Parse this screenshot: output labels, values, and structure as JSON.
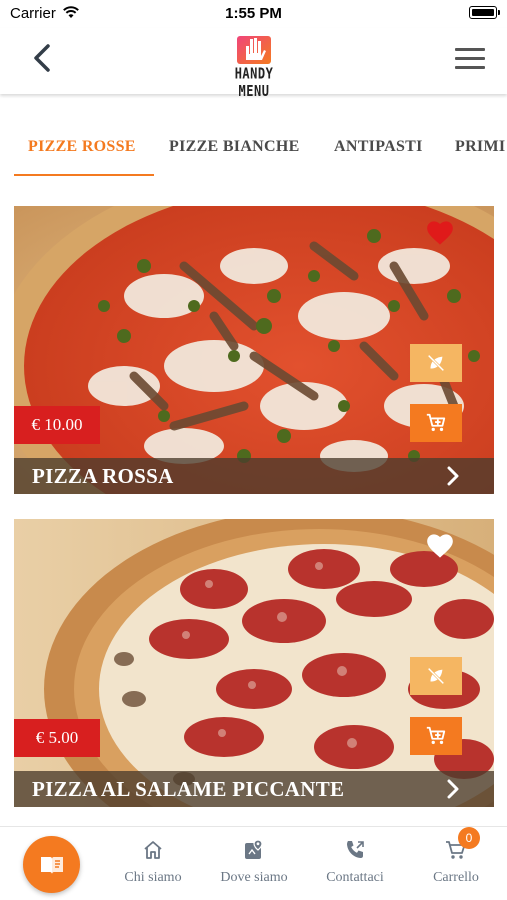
{
  "status_bar": {
    "carrier": "Carrier",
    "time": "1:55 PM"
  },
  "header": {
    "logo_text": "HANDY MENU"
  },
  "tabs": [
    {
      "label": "PIZZE ROSSE",
      "active": true
    },
    {
      "label": "PIZZE BIANCHE",
      "active": false
    },
    {
      "label": "ANTIPASTI",
      "active": false
    },
    {
      "label": "PRIMI",
      "active": false
    }
  ],
  "products": [
    {
      "name": "PIZZA ROSSA",
      "price": "€ 10.00",
      "favorite": true,
      "image": "pizza-with-anchovies-and-capers"
    },
    {
      "name": "PIZZA AL SALAME PICCANTE",
      "price": "€ 5.00",
      "favorite": false,
      "image": "pizza-with-spicy-salami"
    }
  ],
  "bottom_nav": {
    "items": [
      {
        "label": "Chi siamo",
        "icon": "home-icon"
      },
      {
        "label": "Dove siamo",
        "icon": "map-pin-icon"
      },
      {
        "label": "Contattaci",
        "icon": "phone-icon"
      },
      {
        "label": "Carrello",
        "icon": "cart-icon"
      }
    ],
    "cart_count": "0"
  },
  "colors": {
    "accent": "#f47a20",
    "price": "#d81f1f",
    "favorite": "#e01a1a",
    "tab_text": "#4a4a4a"
  }
}
